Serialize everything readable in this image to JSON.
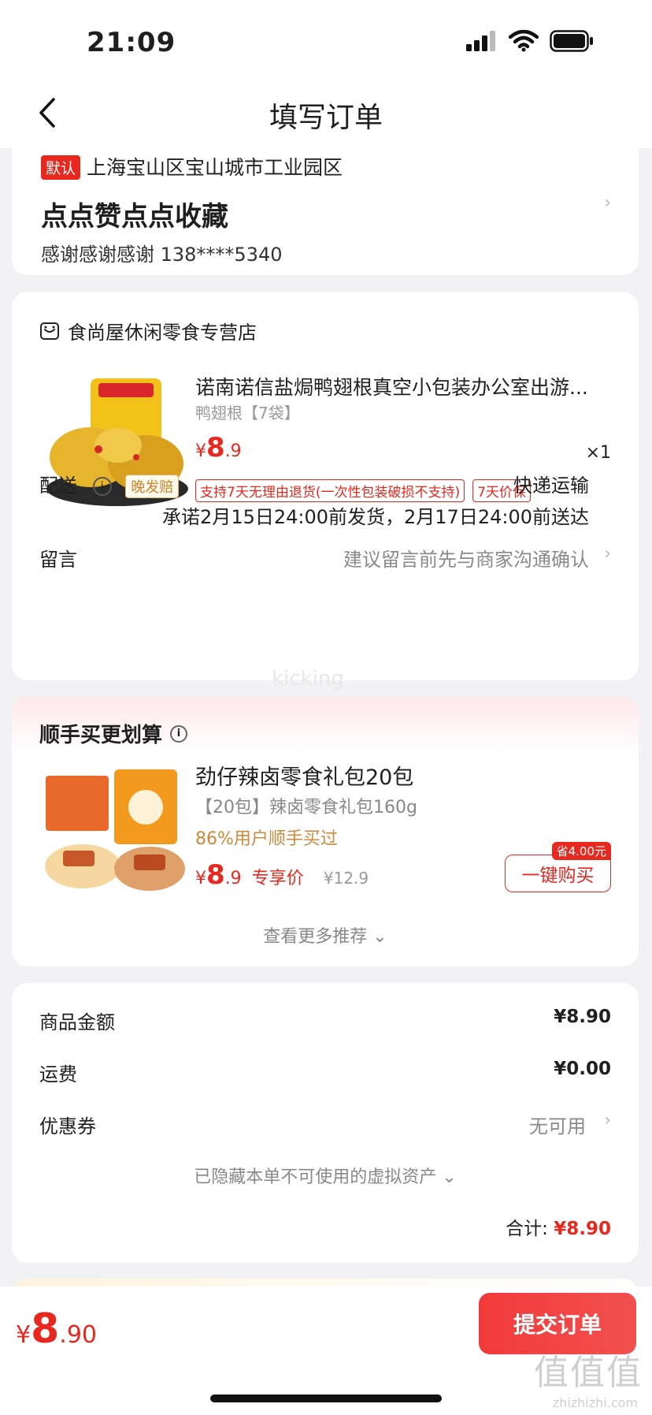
{
  "status": {
    "time": "21:09"
  },
  "nav": {
    "title": "填写订单"
  },
  "address": {
    "tag": "默认",
    "line": "上海宝山区宝山城市工业园区",
    "title": "点点赞点点收藏",
    "contact": "感谢感谢感谢  138****5340"
  },
  "store": {
    "name": "食尚屋休闲零食专营店",
    "product": {
      "name": "诺南诺信盐焗鸭翅根真空小包装办公室出游...",
      "spec": "鸭翅根【7袋】",
      "price_yen": "¥",
      "price_int": "8",
      "price_dec": ".9",
      "qty": "×1",
      "tags": [
        "支持7天无理由退货(一次性包装破损不支持)",
        "7天价保"
      ]
    },
    "delivery": {
      "label": "配送",
      "badge": "晚发赔",
      "method": "快递运输",
      "promise": "承诺2月15日24:00前发货，2月17日24:00前送达"
    },
    "note": {
      "label": "留言",
      "placeholder": "建议留言前先与商家沟通确认"
    }
  },
  "recommend": {
    "title": "顺手买更划算",
    "product": {
      "name": "劲仔辣卤零食礼包20包",
      "spec": "【20包】辣卤零食礼包160g",
      "social": "86%用户顺手买过",
      "price_yen": "¥",
      "price_int": "8",
      "price_dec": ".9",
      "price_label": "专享价",
      "orig_price": "¥12.9",
      "save_badge": "省4.00元",
      "buy_label": "一键购买"
    },
    "more": "查看更多推荐"
  },
  "summary": {
    "goods_label": "商品金额",
    "goods_value": "¥8.90",
    "shipping_label": "运费",
    "shipping_value": "¥0.00",
    "coupon_label": "优惠券",
    "coupon_value": "无可用",
    "hidden_assets": "已隐藏本单不可使用的虚拟资产",
    "total_label": "合计:",
    "total_value": "¥8.90"
  },
  "bottom": {
    "price_yen": "¥",
    "price_int": "8",
    "price_dec": ".90",
    "submit": "提交订单"
  },
  "watermark": {
    "mid": "kicking",
    "main": "值值值",
    "sub": "zhizhizhi.com"
  },
  "colors": {
    "accent": "#e8281e",
    "gold": "#c8842a"
  }
}
